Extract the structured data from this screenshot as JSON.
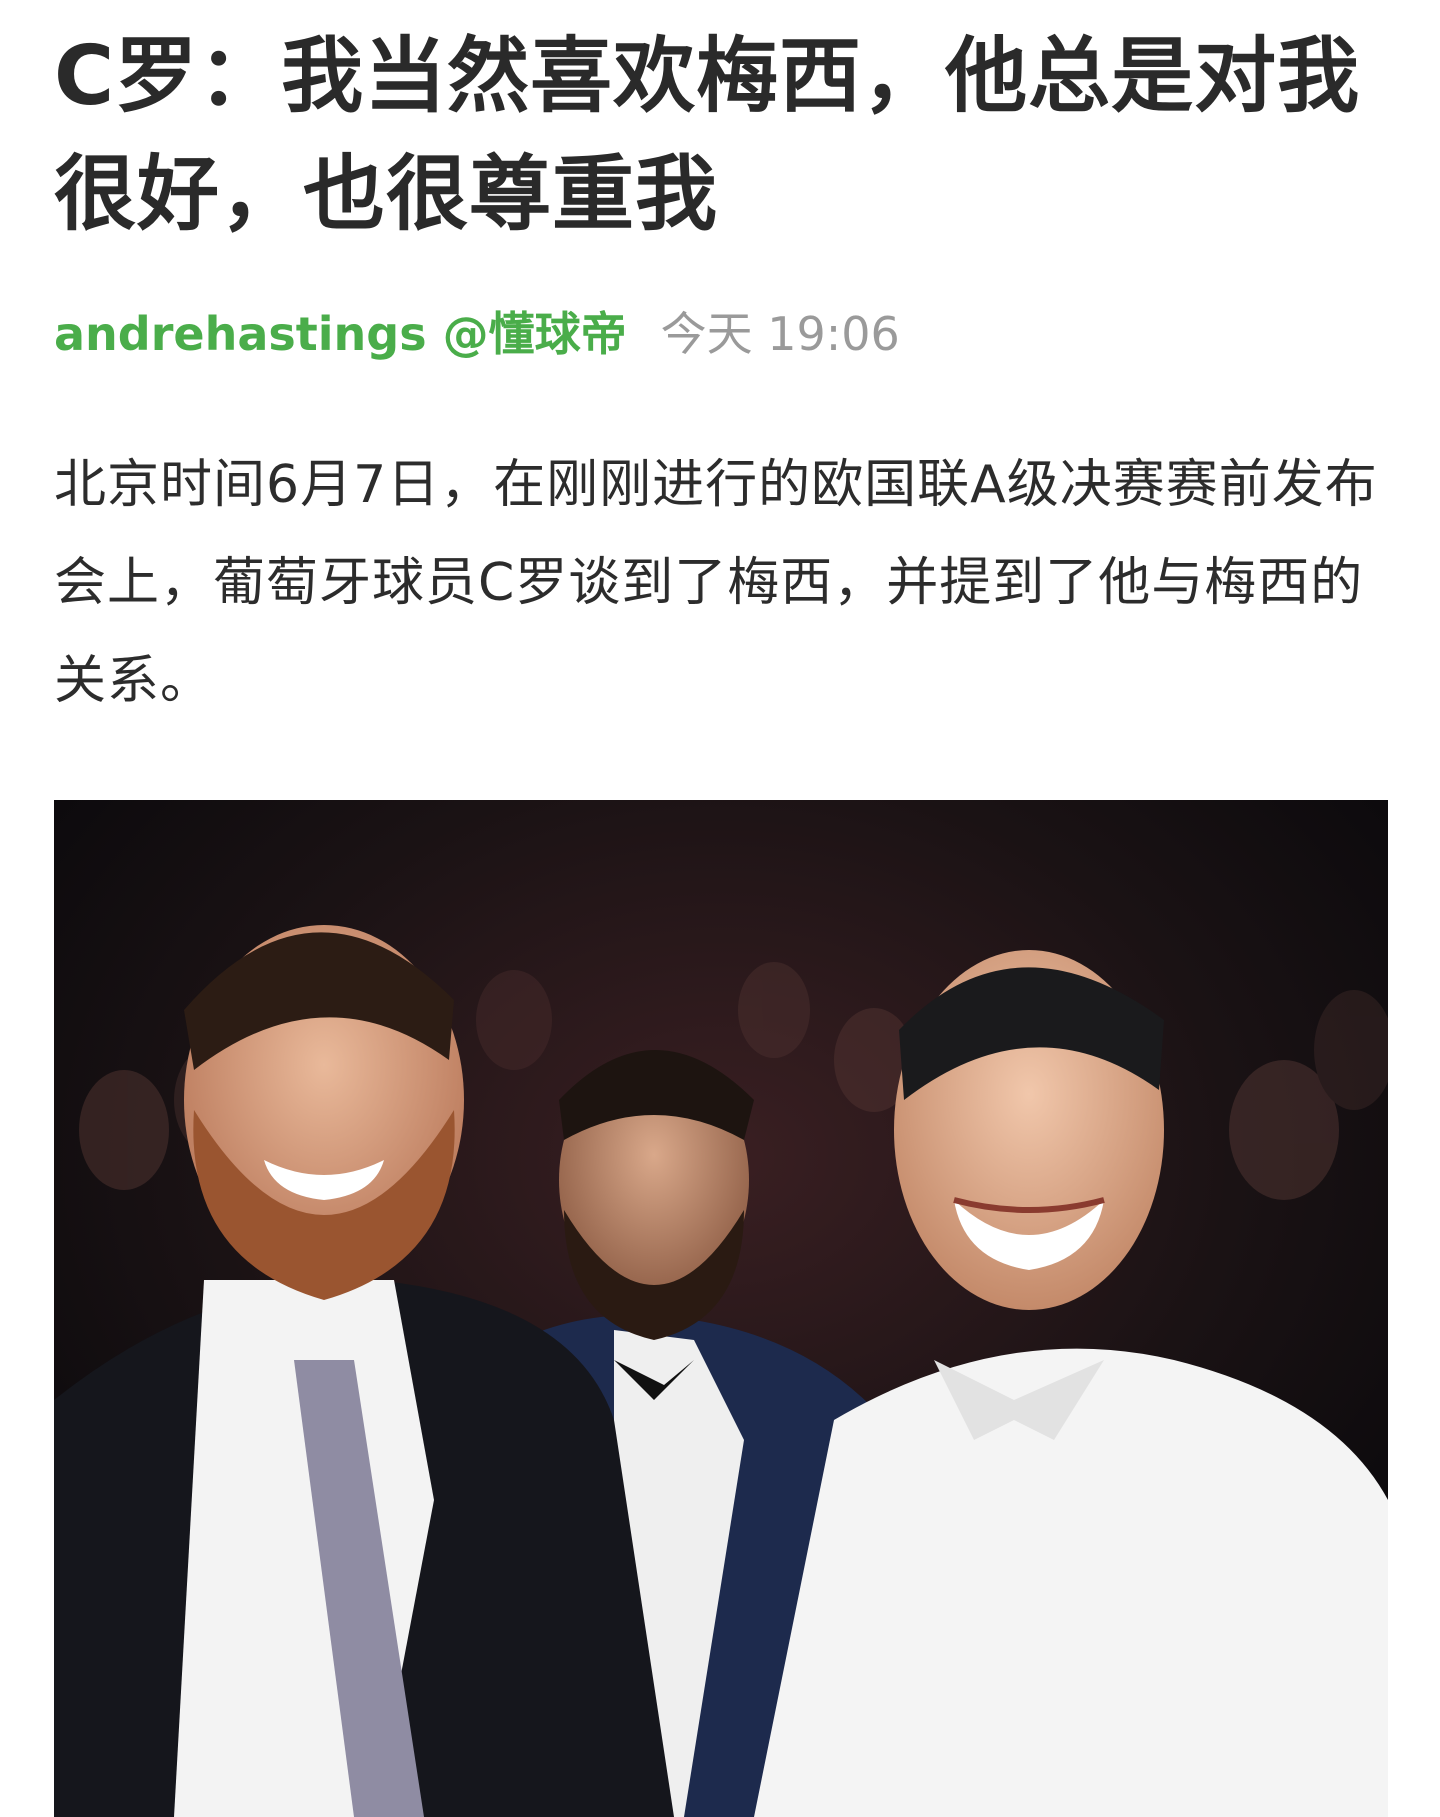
{
  "article": {
    "title": "C罗：我当然喜欢梅西，他总是对我很好，也很尊重我",
    "author": "andrehastings @懂球帝",
    "time": "今天 19:06",
    "lead": "北京时间6月7日，在刚刚进行的欧国联A级决赛赛前发布会上，葡萄牙球员C罗谈到了梅西，并提到了他与梅西的关系。"
  },
  "colors": {
    "author": "#4aad4a",
    "time": "#9a9a9a",
    "text": "#2b2b2b",
    "background": "#ffffff"
  }
}
